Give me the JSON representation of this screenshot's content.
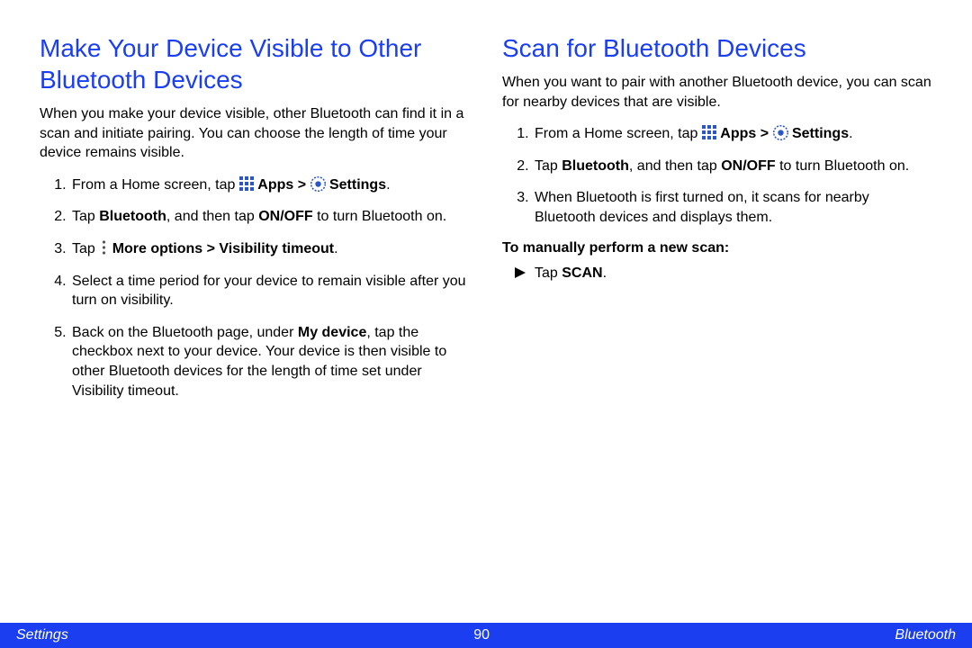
{
  "left": {
    "heading": "Make Your Device Visible to Other Bluetooth Devices",
    "intro": "When you make your device visible, other Bluetooth can find it in a scan and initiate pairing. You can choose the length of time your device remains visible.",
    "steps": {
      "s1_a": "From a Home screen, tap ",
      "s1_apps": "Apps > ",
      "s1_settings": "Settings",
      "s1_end": ".",
      "s2_a": "Tap ",
      "s2_bt": "Bluetooth",
      "s2_b": ", and then tap ",
      "s2_onoff": "ON/OFF",
      "s2_c": " to turn Bluetooth on.",
      "s3_a": "Tap ",
      "s3_more": "More options > Visibility timeout",
      "s3_end": ".",
      "s4": "Select a time period for your device to remain visible after you turn on visibility.",
      "s5_a": "Back on the Bluetooth page, under ",
      "s5_my": "My device",
      "s5_b": ", tap the checkbox next to your device. Your device is then visible to other Bluetooth devices for the length of time set under Visibility timeout."
    }
  },
  "right": {
    "heading": "Scan for Bluetooth Devices",
    "intro": "When you want to pair with another Bluetooth device, you can scan for nearby devices that are visible.",
    "steps": {
      "s1_a": "From a Home screen, tap ",
      "s1_apps": "Apps > ",
      "s1_settings": "Settings",
      "s1_end": ".",
      "s2_a": "Tap ",
      "s2_bt": "Bluetooth",
      "s2_b": ", and then tap ",
      "s2_onoff": "ON/OFF",
      "s2_c": " to turn Bluetooth on.",
      "s3": "When Bluetooth is first turned on, it scans for nearby Bluetooth devices and displays them."
    },
    "sub_heading": "To manually perform a new scan:",
    "scan_a": "Tap ",
    "scan_b": "SCAN",
    "scan_end": "."
  },
  "footer": {
    "left": "Settings",
    "page": "90",
    "right": "Bluetooth"
  }
}
